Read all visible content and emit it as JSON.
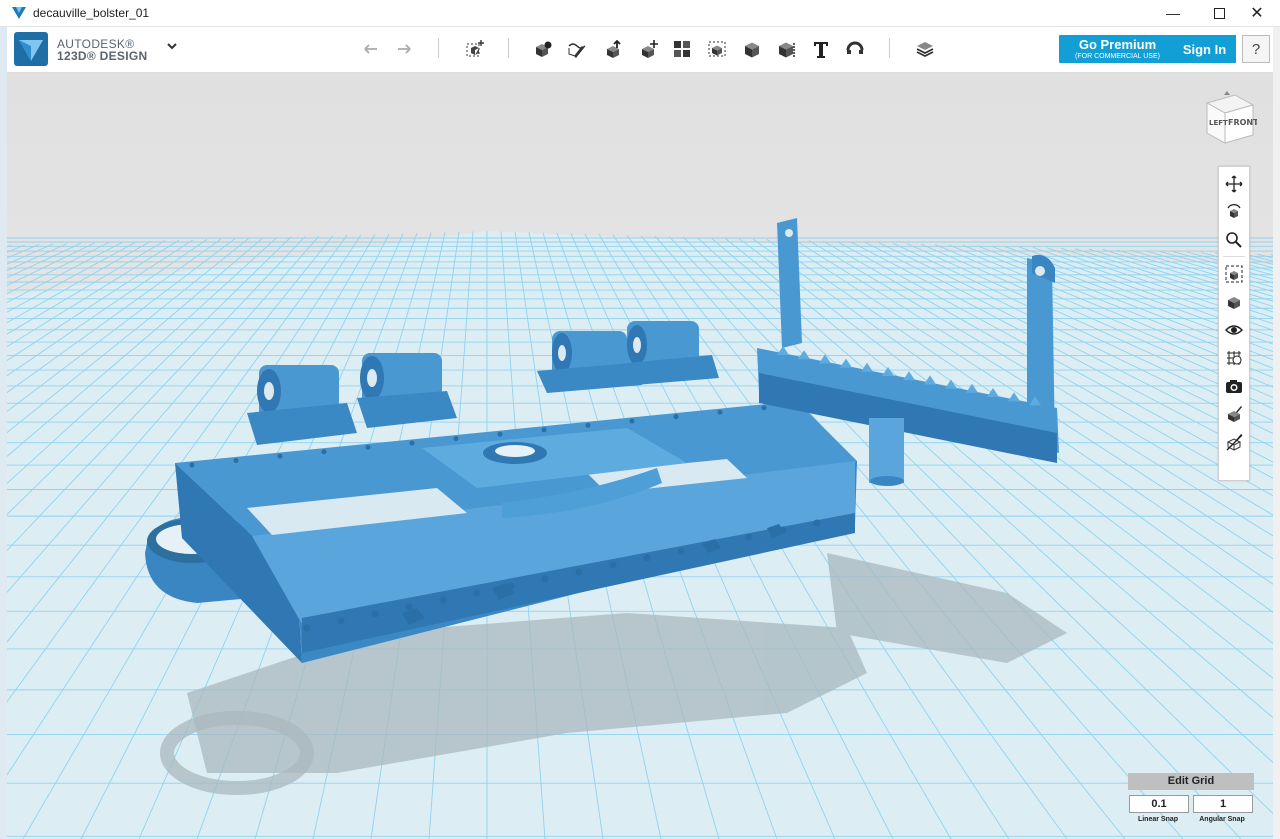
{
  "window": {
    "title": "decauville_bolster_01",
    "minimize_icon": "minimize-icon",
    "maximize_icon": "maximize-icon",
    "close_icon": "close-icon"
  },
  "brand": {
    "line1": "AUTODESK®",
    "line2": "123D® DESIGN"
  },
  "toolbar": {
    "tools": [
      "undo-icon",
      "redo-icon",
      "transform-icon",
      "primitives-icon",
      "sketch-icon",
      "construct-icon",
      "modify-icon",
      "pattern-icon",
      "grouping-icon",
      "combine-icon",
      "measure-icon",
      "text-icon",
      "snap-icon",
      "material-icon"
    ]
  },
  "header_buttons": {
    "premium_label": "Go Premium",
    "premium_sublabel": "(FOR COMMERCIAL USE)",
    "signin_label": "Sign In",
    "help_label": "?"
  },
  "viewcube": {
    "face_left": "LEFT",
    "face_front": "FRONT"
  },
  "nav_tools": [
    "pan-icon",
    "orbit-icon",
    "zoom-icon",
    "fit-icon",
    "view-icon",
    "visibility-icon",
    "grid-view-icon",
    "camera-icon",
    "material-toggle-icon",
    "outline-toggle-icon"
  ],
  "edit_grid": {
    "title": "Edit Grid",
    "linear_value": "0.1",
    "angular_value": "1",
    "linear_label": "Linear Snap",
    "angular_label": "Angular Snap"
  },
  "colors": {
    "accent": "#119fd6",
    "model": "#3d8fcc",
    "grid_line": "#8fd3ef",
    "ground": "#dbeef6"
  }
}
